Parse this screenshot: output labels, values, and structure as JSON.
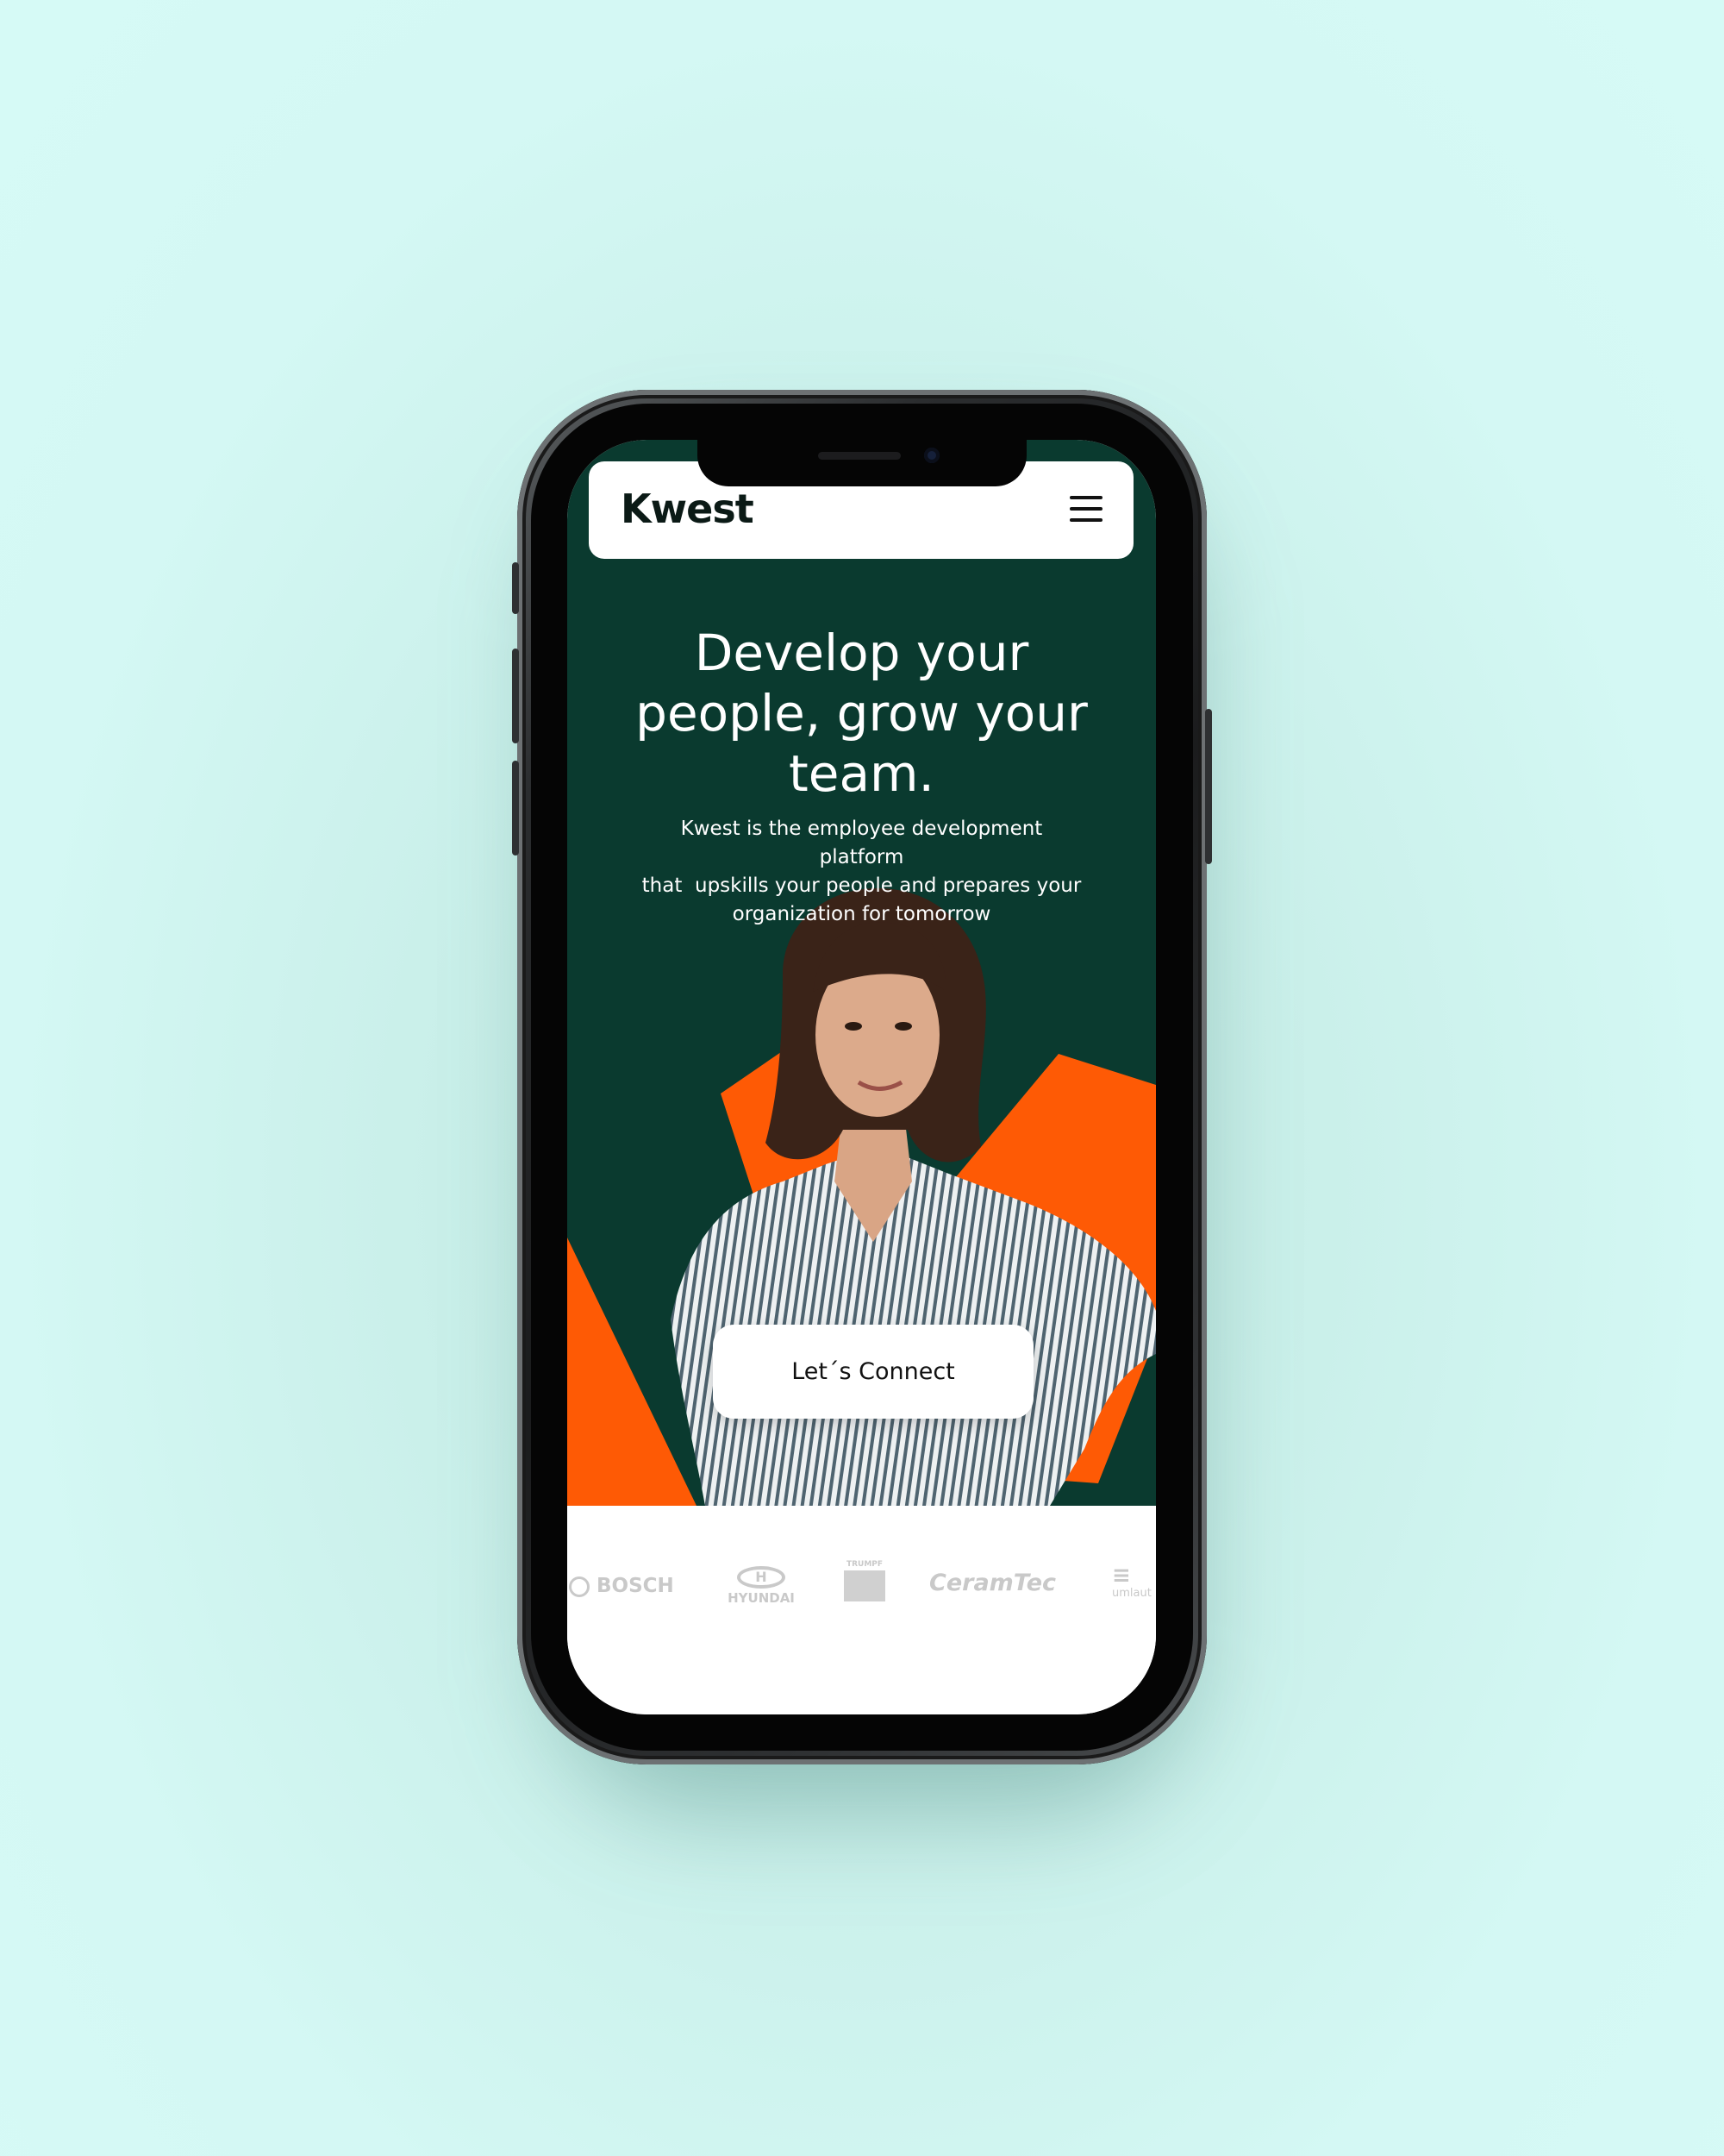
{
  "navbar": {
    "logo_text": "Kwest",
    "menu_icon": "hamburger-menu-icon"
  },
  "hero": {
    "headline_line1": "Develop your",
    "headline_line2": "people, grow your",
    "headline_line3": "team.",
    "subtext_line1": "Kwest is the employee development platform",
    "subtext_line2": "that  upskills your people and prepares your",
    "subtext_line3": "organization for tomorrow",
    "cta_label": "Let´s Connect"
  },
  "logos": [
    {
      "name": "BOSCH"
    },
    {
      "name": "HYUNDAI"
    },
    {
      "name": "TRUMPF"
    },
    {
      "name": "CeramTec"
    },
    {
      "name": "umlaut"
    }
  ],
  "colors": {
    "page_background": "#d4f8f4",
    "hero_background": "#0a3a2f",
    "accent_orange": "#fe5a05",
    "button_background": "#ffffff",
    "logo_gray": "#c9c9c9"
  }
}
